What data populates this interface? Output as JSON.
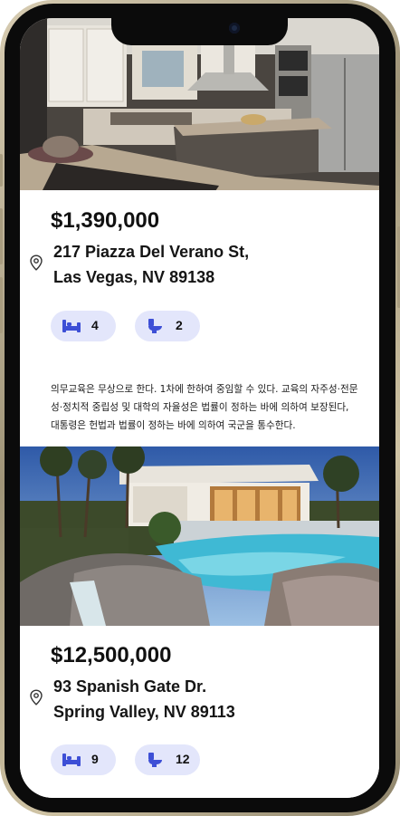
{
  "listings": [
    {
      "photo": "kitchen-interior",
      "price": "$1,390,000",
      "address_line1": "217 Piazza Del Verano St,",
      "address_line2": "Las Vegas, NV 89138",
      "bedrooms": "4",
      "bathrooms": "2",
      "description": "의무교육은 무상으로 한다. 1차에 한하여 중임할 수 있다. 교육의 자주성·전문성·정치적 중립성 및 대학의 자율성은 법률이 정하는 바에 의하여 보장된다, 대통령은 헌법과 법률이 정하는 바에 의하여 국군을 통수한다."
    },
    {
      "photo": "mansion-pool",
      "price": "$12,500,000",
      "address_line1": "93 Spanish Gate Dr.",
      "address_line2": "Spring Valley, NV 89113",
      "bedrooms": "9",
      "bathrooms": "12"
    }
  ],
  "icons": {
    "location": "location-pin-icon",
    "bed": "bed-icon",
    "bath": "toilet-icon"
  },
  "colors": {
    "accent": "#3d4fd6",
    "pill_bg": "#e3e6fb"
  }
}
